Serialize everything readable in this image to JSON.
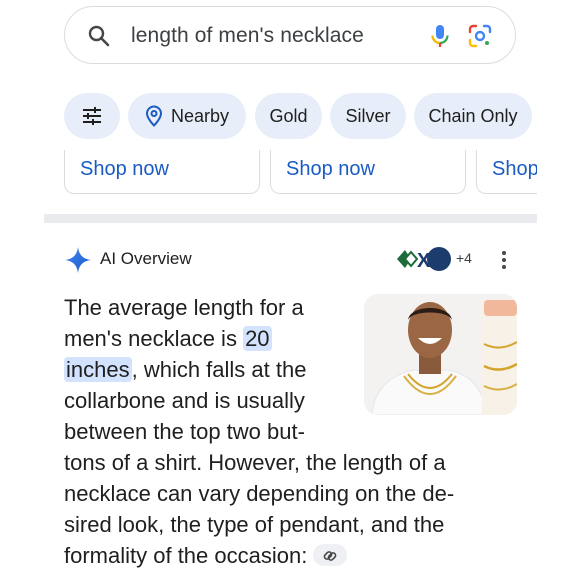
{
  "search": {
    "query": "length of men's necklace"
  },
  "chips": [
    {
      "label": ""
    },
    {
      "label": "Nearby"
    },
    {
      "label": "Gold"
    },
    {
      "label": "Silver"
    },
    {
      "label": "Chain Only"
    }
  ],
  "shop_cards": [
    {
      "label": "Shop now"
    },
    {
      "label": "Shop now"
    },
    {
      "label": "Shop"
    }
  ],
  "ai_overview": {
    "title": "AI Overview",
    "source_logo_text": "XT",
    "more_sources": "+4",
    "lines": {
      "l1": "The average length for a",
      "l2_pre": "men's necklace is ",
      "l2_hl": "20",
      "l3_hl": "inches",
      "l3_post": ", which falls at the",
      "l4": "collarbone and is usually",
      "l5": "between the top two but-",
      "l6": "tons of a shirt. However, the length of a",
      "l7": "necklace can vary depending on the de-",
      "l8": "sired look, the type of pendant, and the",
      "l9": "formality of the occasion:"
    }
  },
  "colors": {
    "accent": "#1a5bc4",
    "chip_bg": "#e8eef9",
    "highlight": "#d3e3fd",
    "mic_blue": "#4285f4",
    "mic_green": "#34a853",
    "mic_red": "#ea4335",
    "mic_yellow": "#fbbc04"
  },
  "icons": [
    "search-icon",
    "microphone-icon",
    "google-lens-icon",
    "filter-icon",
    "location-pin-icon",
    "ai-sparkle-icon",
    "more-vert-icon",
    "link-icon"
  ]
}
